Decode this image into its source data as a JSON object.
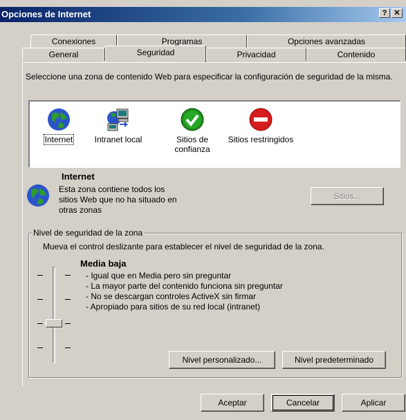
{
  "window": {
    "title": "Opciones de Internet",
    "help_label": "?",
    "close_label": "✕"
  },
  "tabs": {
    "back_row": [
      "Conexiones",
      "Programas",
      "Opciones avanzadas"
    ],
    "front_row": [
      "General",
      "Seguridad",
      "Privacidad",
      "Contenido"
    ],
    "active": "Seguridad"
  },
  "intro_text": "Seleccione una zona de contenido Web para especificar la configuración de seguridad de la misma.",
  "zones": [
    {
      "label": "Internet",
      "icon": "globe-icon"
    },
    {
      "label": "Intranet local",
      "icon": "computer-network-icon"
    },
    {
      "label": "Sitios de confianza",
      "icon": "green-check-icon"
    },
    {
      "label": "Sitios restringidos",
      "icon": "red-no-entry-icon"
    }
  ],
  "selected_zone": {
    "title": "Internet",
    "description": "Esta zona contiene todos los sitios Web que no ha situado en otras zonas",
    "sites_button": "Sitios..."
  },
  "security_level": {
    "group_label": "Nivel de seguridad de la zona",
    "instruction": "Mueva el control deslizante para establecer el nivel de seguridad de la zona.",
    "level_name": "Media baja",
    "bullets": [
      "- Igual que en Media pero sin preguntar",
      "- La mayor parte del contenido funciona sin preguntar",
      "- No se descargan controles ActiveX sin firmar",
      "- Apropiado para sitios de su red local (intranet)"
    ],
    "slider_level": 2,
    "slider_levels": 4,
    "custom_button": "Nivel personalizado...",
    "default_button": "Nivel predeterminado"
  },
  "footer": {
    "ok": "Aceptar",
    "cancel": "Cancelar",
    "apply": "Aplicar"
  }
}
